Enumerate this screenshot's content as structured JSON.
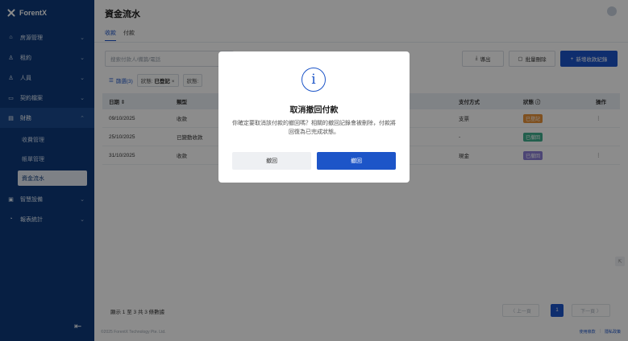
{
  "brand": {
    "name": "ForentX"
  },
  "sidebar": {
    "items": [
      {
        "label": "房源管理",
        "icon": "home-icon"
      },
      {
        "label": "租約",
        "icon": "user-icon"
      },
      {
        "label": "人員",
        "icon": "people-icon"
      },
      {
        "label": "契約檔案",
        "icon": "folder-icon"
      },
      {
        "label": "財務",
        "icon": "finance-icon"
      },
      {
        "label": "智慧設備",
        "icon": "device-icon"
      },
      {
        "label": "報表統計",
        "icon": "chart-icon"
      }
    ],
    "finance_sub": [
      "收費管理",
      "帳單管理",
      "資金流水"
    ]
  },
  "header": {
    "title": "資金流水"
  },
  "tabs": [
    "收款",
    "付款"
  ],
  "toolbar": {
    "search_placeholder": "搜索付款人/備篇/電話",
    "export": "導出",
    "batch_delete": "批量刪除",
    "new_record": "新增收款紀錄"
  },
  "filters": {
    "filter_label": "篩選(3)",
    "chip1_key": "狀態:",
    "chip1_val": "已登記",
    "chip2_key": "狀態:"
  },
  "table": {
    "headers": {
      "date": "日期 ⇕",
      "type": "類型",
      "pay": "支付方式",
      "status": "狀態 ⓘ",
      "action": "操作"
    },
    "rows": [
      {
        "date": "09/10/2025",
        "type": "收款",
        "pay": "支票",
        "status": "已登記",
        "status_color": "#e8923a",
        "action": "⋮"
      },
      {
        "date": "25/10/2025",
        "type": "已變動收款",
        "pay": "-",
        "status": "已撤回",
        "status_color": "#3fae8c",
        "action": ""
      },
      {
        "date": "31/10/2025",
        "type": "收款",
        "pay": "現金",
        "status": "已撤回",
        "status_color": "#8a7fd6",
        "action": "⋮"
      }
    ]
  },
  "footer": {
    "count": "顯示 1 至 3 共 3 條數據",
    "prev": "〈 上一頁",
    "page": "1",
    "next": "下一頁 〉",
    "copyright": "©2025 ForentX Technology Pte. Ltd.",
    "link1": "使用條款",
    "link2": "隱私政策"
  },
  "modal": {
    "icon_glyph": "i",
    "title": "取消撤回付款",
    "message": "你確定要取消該付款的撤回嗎？相關的撤回記錄會被刪除，付款將回復為已完成狀態。",
    "cancel": "撤回",
    "confirm": "撤回"
  }
}
